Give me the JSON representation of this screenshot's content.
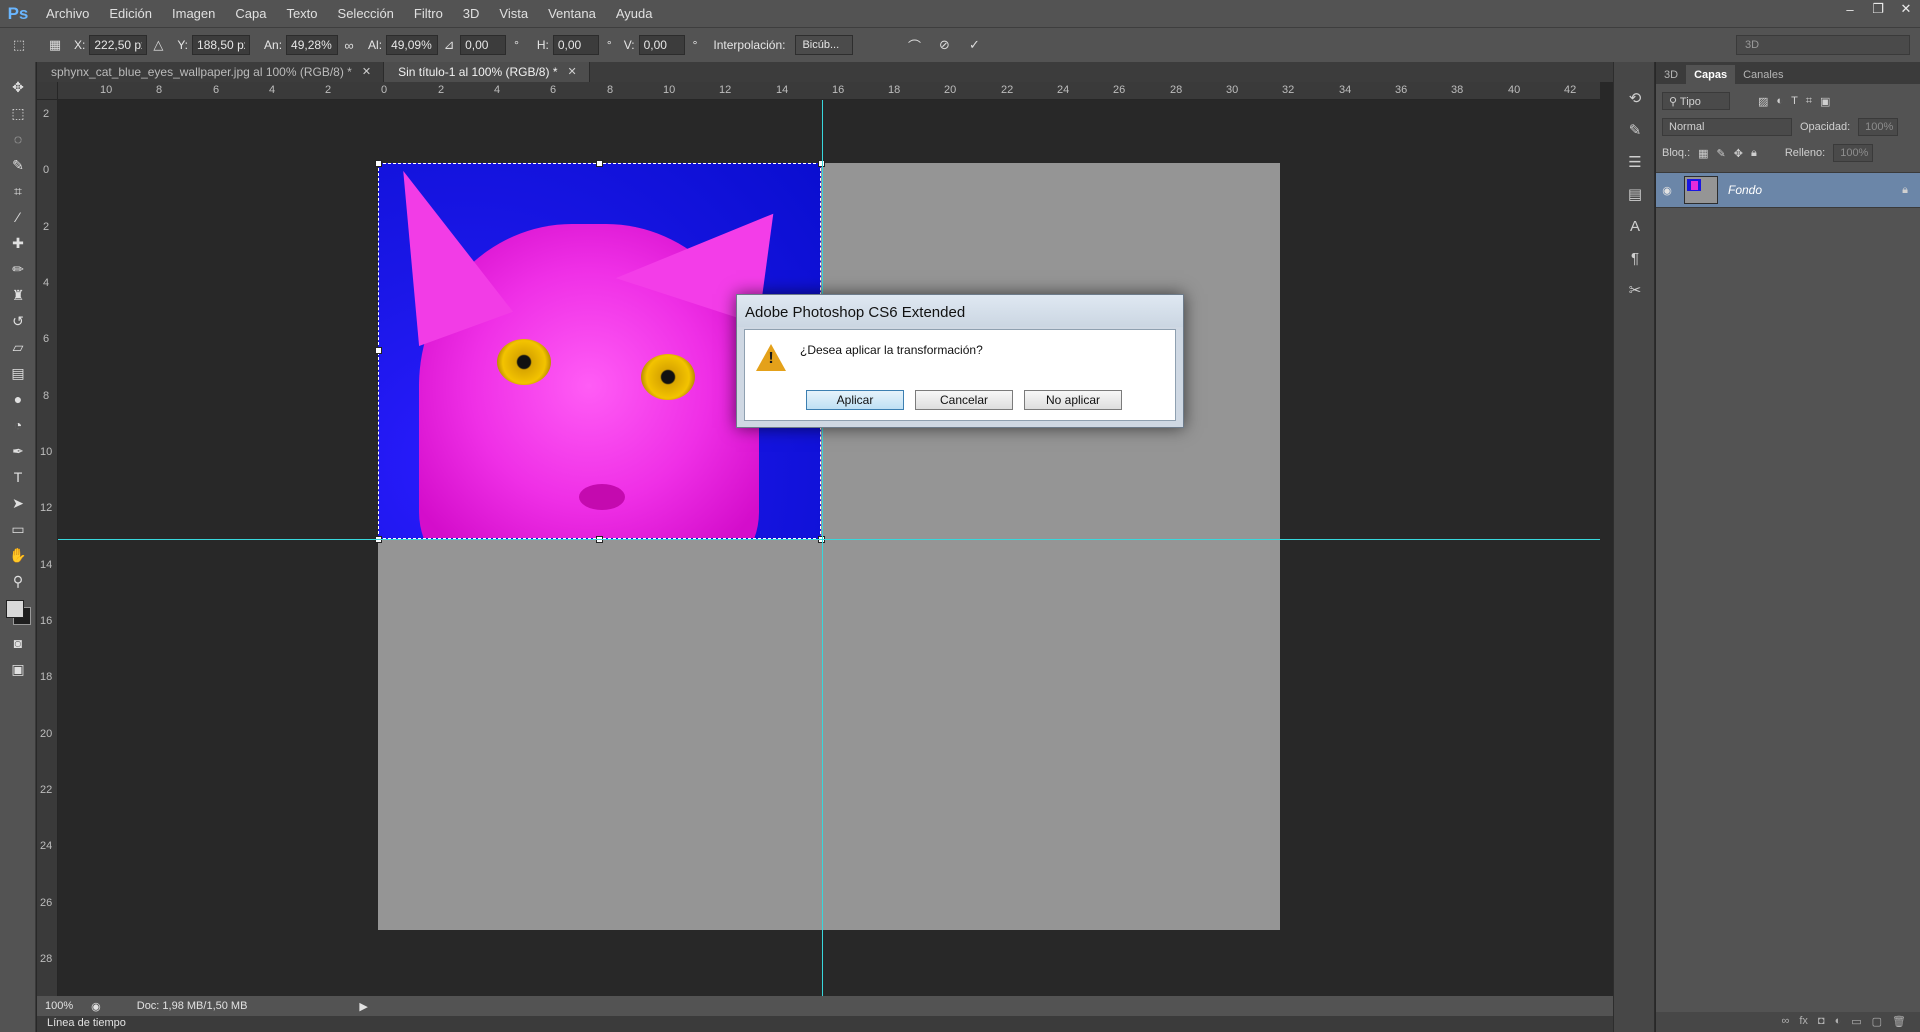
{
  "app": {
    "logo": "Ps",
    "menu": [
      "Archivo",
      "Edición",
      "Imagen",
      "Capa",
      "Texto",
      "Selección",
      "Filtro",
      "3D",
      "Vista",
      "Ventana",
      "Ayuda"
    ],
    "window_controls": [
      "–",
      "❐",
      "✕"
    ]
  },
  "options": {
    "x_label": "X:",
    "x_value": "222,50 px",
    "y_label": "Y:",
    "y_value": "188,50 px",
    "w_label": "An:",
    "w_value": "49,28%",
    "h_label": "Al:",
    "h_value": "49,09%",
    "rot_value": "0,00",
    "hskew_label": "H:",
    "hskew_value": "0,00",
    "vskew_label": "V:",
    "vskew_value": "0,00",
    "interp_label": "Interpolación:",
    "interp_value": "Bicúb...",
    "workspace": "3D"
  },
  "tabs": [
    {
      "label": "sphynx_cat_blue_eyes_wallpaper.jpg al 100% (RGB/8) *",
      "active": false
    },
    {
      "label": "Sin título-1 al 100% (RGB/8) *",
      "active": true
    }
  ],
  "ruler_top": [
    "10",
    "8",
    "6",
    "4",
    "2",
    "0",
    "2",
    "4",
    "6",
    "8",
    "10",
    "12",
    "14",
    "16",
    "18",
    "20",
    "22",
    "24",
    "26",
    "28",
    "30",
    "32",
    "34",
    "36",
    "38",
    "40",
    "42"
  ],
  "ruler_left": [
    "2",
    "0",
    "2",
    "4",
    "6",
    "8",
    "10",
    "12",
    "14",
    "16",
    "18",
    "20",
    "22",
    "24",
    "26",
    "28"
  ],
  "layers_panel": {
    "tabs": [
      "3D",
      "Capas",
      "Canales"
    ],
    "active_tab": "Capas",
    "filter": "Tipo",
    "blend_mode": "Normal",
    "opacity_label": "Opacidad:",
    "opacity_value": "100%",
    "lock_label": "Bloq.:",
    "fill_label": "Relleno:",
    "fill_value": "100%",
    "layers": [
      {
        "name": "Fondo",
        "visible": true,
        "locked": true
      }
    ]
  },
  "status": {
    "zoom": "100%",
    "doc": "Doc: 1,98 MB/1,50 MB",
    "timeline": "Línea de tiempo"
  },
  "dialog": {
    "title": "Adobe Photoshop CS6 Extended",
    "message": "¿Desea aplicar la transformación?",
    "buttons": {
      "apply": "Aplicar",
      "cancel": "Cancelar",
      "dont_apply": "No aplicar"
    }
  },
  "colors": {
    "guide": "#38d7dc",
    "canvas_bg": "#959595",
    "workspace_bg": "#282828"
  }
}
